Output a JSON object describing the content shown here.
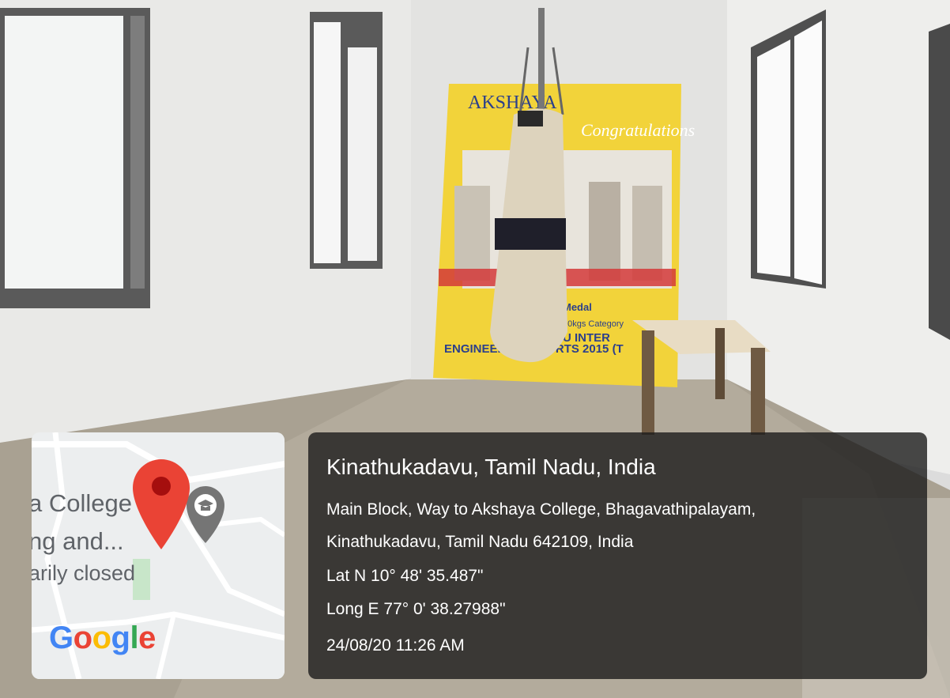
{
  "photo": {
    "banner": {
      "brand": "AKSHAYA",
      "headline": "Congratulations",
      "line_medal": "Medal",
      "line_category": "90kgs Category",
      "line_inter": "U INTER",
      "line_event": "ENGINEERING SPORTS 2015 (T"
    }
  },
  "map": {
    "place_line1": "a College",
    "place_line2": "ng and...",
    "place_line3": "arily closed",
    "logo": {
      "G": "G",
      "o1": "o",
      "o2": "o",
      "g": "g",
      "l": "l",
      "e": "e"
    },
    "pin_color": "#ea4335",
    "school_pin_color": "#757575"
  },
  "overlay": {
    "title": "Kinathukadavu, Tamil Nadu, India",
    "address_line1": "Main Block, Way to Akshaya College, Bhagavathipalayam,",
    "address_line2": "Kinathukadavu, Tamil Nadu 642109, India",
    "latitude": "Lat N 10° 48' 35.487\"",
    "longitude": "Long E 77° 0' 38.27988\"",
    "timestamp": "24/08/20 11:26 AM"
  }
}
